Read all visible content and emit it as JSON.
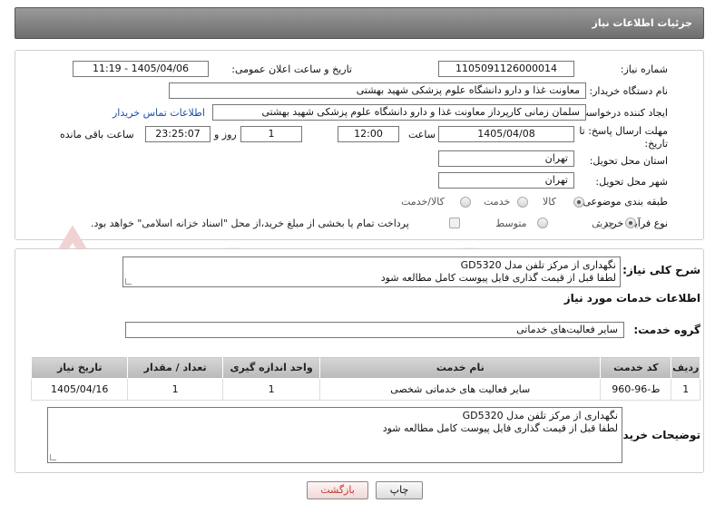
{
  "header": {
    "title": "جزئیات اطلاعات نیاز"
  },
  "fields": {
    "need_number_label": "شماره نیاز:",
    "need_number": "1105091126000014",
    "announce_label": "تاریخ و ساعت اعلان عمومی:",
    "announce_value": "1405/04/06 - 11:19",
    "buyer_org_label": "نام دستگاه خریدار:",
    "buyer_org": "معاونت غذا و دارو دانشگاه علوم پزشکی شهید بهشتی",
    "requester_label": "ایجاد کننده درخواست:",
    "requester": "سلمان زمانی کارپرداز معاونت غذا و دارو دانشگاه علوم پزشکی شهید بهشتی",
    "contact_link": "اطلاعات تماس خریدار",
    "deadline_label_1": "مهلت ارسال پاسخ: تا",
    "deadline_label_2": "تاریخ:",
    "deadline_date": "1405/04/08",
    "time_label": "ساعت",
    "deadline_time": "12:00",
    "days_value": "1",
    "days_label": "روز و",
    "remaining_time": "23:25:07",
    "remaining_label": "ساعت باقی مانده",
    "province_label": "استان محل تحویل:",
    "province": "تهران",
    "city_label": "شهر محل تحویل:",
    "city": "تهران",
    "category_label": "طبقه بندی موضوعی:",
    "category_options": [
      "کالا",
      "خدمت",
      "کالا/خدمت"
    ],
    "process_label": "نوع فرآیند خرید :",
    "process_options": [
      "جزیی",
      "متوسط"
    ],
    "payment_note": "پرداخت تمام یا بخشی از مبلغ خرید،از محل \"اسناد خزانه اسلامی\" خواهد بود."
  },
  "summary": {
    "label": "شرح کلی نیاز:",
    "text_line1": "نگهداری از مرکز تلفن مدل GD5320",
    "text_line2": "لطفا قبل از قیمت گذاری فایل پیوست کامل مطالعه شود"
  },
  "services": {
    "section_title": "اطلاعات خدمات مورد نیاز",
    "group_label": "گروه خدمت:",
    "group_value": "سایر فعالیت‌های خدماتی",
    "columns": [
      "ردیف",
      "کد خدمت",
      "نام خدمت",
      "واحد اندازه گیری",
      "تعداد / مقدار",
      "تاریخ نیاز"
    ],
    "rows": [
      {
        "row": "1",
        "code": "ط-96-960",
        "name": "سایر فعالیت های خدماتی شخصی",
        "unit": "1",
        "qty": "1",
        "date": "1405/04/16"
      }
    ]
  },
  "buyer_notes": {
    "label": "توضیحات خریدار:",
    "line1": "نگهداری از مرکز تلفن مدل GD5320",
    "line2": "لطفا قبل از قیمت گذاری فایل پیوست کامل مطالعه شود"
  },
  "buttons": {
    "print": "چاپ",
    "back": "بازگشت"
  },
  "watermark": {
    "text": "AriaTender.net"
  },
  "colors": {
    "header_bg": "#7f7f7f",
    "link": "#1a4fa8",
    "back_button_text": "#c0392b",
    "watermark": "#f3d6d6"
  }
}
